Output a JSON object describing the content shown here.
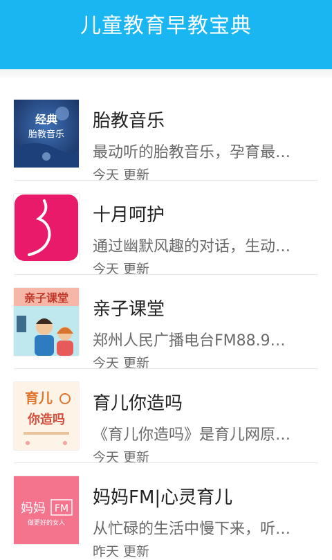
{
  "header": {
    "title": "儿童教育早教宝典"
  },
  "items": [
    {
      "title": "胎教音乐",
      "description": "最动听的胎教音乐，孕育最…",
      "updated": "今天 更新",
      "thumb_text": [
        "经典",
        "胎教音乐"
      ],
      "thumb_icon": "fetal-music-cover-icon"
    },
    {
      "title": "十月呵护",
      "description": "通过幽默风趣的对话，生动…",
      "updated": "今天 更新",
      "thumb_icon": "pregnancy-logo-icon"
    },
    {
      "title": "亲子课堂",
      "description": "郑州人民广播电台FM88.9…",
      "updated": "今天 更新",
      "thumb_text": [
        "亲子课堂"
      ],
      "thumb_icon": "family-classroom-cover-icon"
    },
    {
      "title": "育儿你造吗",
      "description": "《育儿你造吗》是育儿网原…",
      "updated": "今天 更新",
      "thumb_text": [
        "育儿",
        "你造吗"
      ],
      "thumb_icon": "parenting-cover-icon"
    },
    {
      "title": "妈妈FM|心灵育儿",
      "description": "从忙碌的生活中慢下来，听…",
      "updated": "昨天 更新",
      "thumb_text": [
        "妈妈",
        "FM",
        "做更好的女人"
      ],
      "thumb_icon": "mama-fm-cover-icon"
    }
  ],
  "colors": {
    "header_bg": "#1ab6f2",
    "header_text": "#ffffff",
    "thumb2_bg": "#ea1a6a",
    "thumb5_bg": "#f4748e"
  }
}
